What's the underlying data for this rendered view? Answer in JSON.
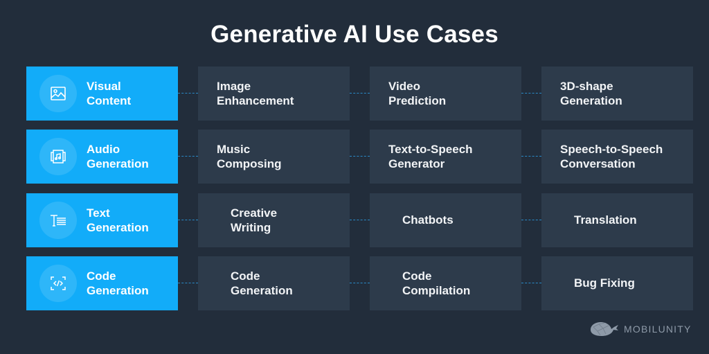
{
  "title": "Generative AI Use Cases",
  "accent_color": "#12acf9",
  "rows": [
    {
      "category": {
        "label_line1": "Visual",
        "label_line2": "Content",
        "icon": "image-icon"
      },
      "items": [
        {
          "line1": "Image",
          "line2": "Enhancement"
        },
        {
          "line1": "Video",
          "line2": "Prediction"
        },
        {
          "line1": "3D-shape",
          "line2": "Generation"
        }
      ]
    },
    {
      "category": {
        "label_line1": "Audio",
        "label_line2": "Generation",
        "icon": "music-icon"
      },
      "items": [
        {
          "line1": "Music",
          "line2": "Composing"
        },
        {
          "line1": "Text-to-Speech",
          "line2": "Generator"
        },
        {
          "line1": "Speech-to-Speech",
          "line2": "Conversation"
        }
      ]
    },
    {
      "category": {
        "label_line1": "Text",
        "label_line2": "Generation",
        "icon": "text-icon"
      },
      "items": [
        {
          "line1": "Creative",
          "line2": "Writing"
        },
        {
          "line1": "Chatbots",
          "line2": ""
        },
        {
          "line1": "Translation",
          "line2": ""
        }
      ]
    },
    {
      "category": {
        "label_line1": "Code",
        "label_line2": "Generation",
        "icon": "code-icon"
      },
      "items": [
        {
          "line1": "Code",
          "line2": "Generation"
        },
        {
          "line1": "Code",
          "line2": "Compilation"
        },
        {
          "line1": "Bug Fixing",
          "line2": ""
        }
      ]
    }
  ],
  "brand": {
    "name": "MOBILUNITY",
    "icon": "whale-logo-icon"
  }
}
